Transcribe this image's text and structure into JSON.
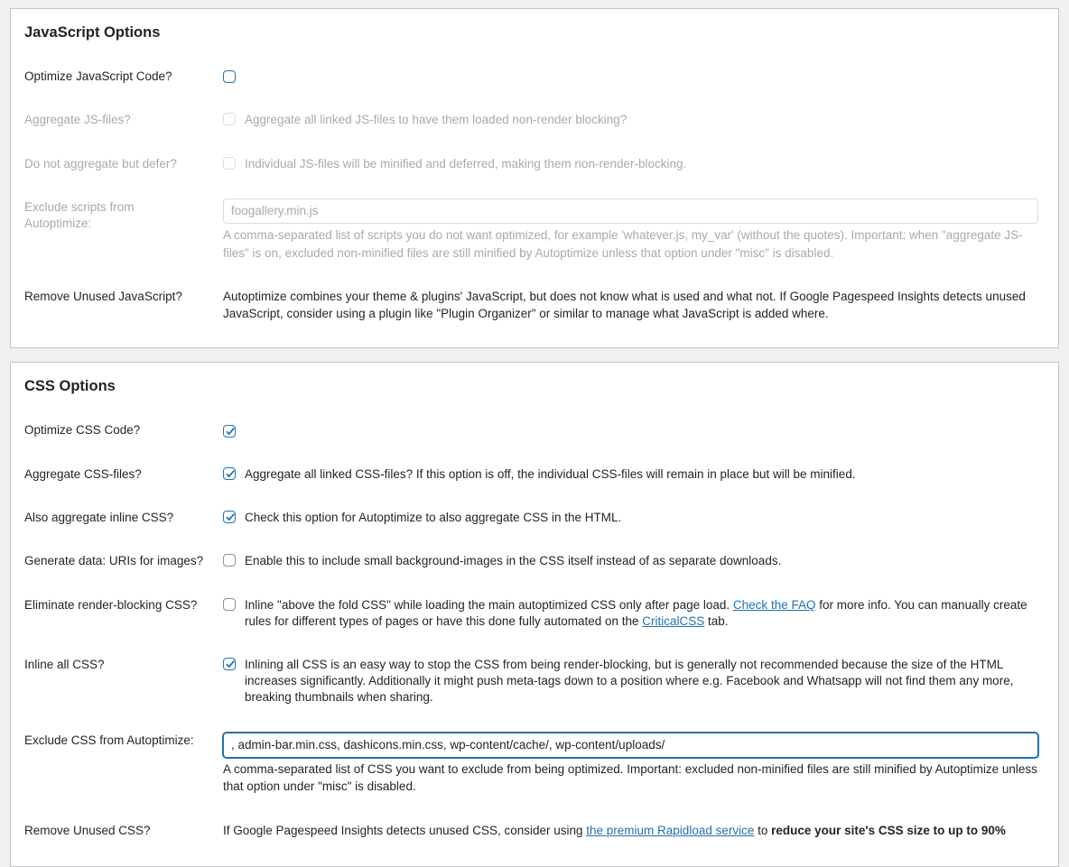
{
  "js": {
    "title": "JavaScript Options",
    "optimize": {
      "label": "Optimize JavaScript Code?",
      "checked": false
    },
    "aggregate": {
      "label": "Aggregate JS-files?",
      "text": "Aggregate all linked JS-files to have them loaded non-render blocking?",
      "checked": false
    },
    "defer": {
      "label": "Do not aggregate but defer?",
      "text": "Individual JS-files will be minified and deferred, making them non-render-blocking.",
      "checked": false
    },
    "exclude": {
      "label": "Exclude scripts from Autoptimize:",
      "value": "foogallery.min.js",
      "desc": "A comma-separated list of scripts you do not want optimized, for example 'whatever.js, my_var' (without the quotes). Important: when \"aggregate JS-files\" is on, excluded non-minified files are still minified by Autoptimize unless that option under \"misc\" is disabled."
    },
    "unused": {
      "label": "Remove Unused JavaScript?",
      "text": "Autoptimize combines your theme & plugins' JavaScript, but does not know what is used and what not. If Google Pagespeed Insights detects unused JavaScript, consider using a plugin like \"Plugin Organizer\" or similar to manage what JavaScript is added where."
    }
  },
  "css": {
    "title": "CSS Options",
    "optimize": {
      "label": "Optimize CSS Code?",
      "checked": true
    },
    "aggregate": {
      "label": "Aggregate CSS-files?",
      "text": "Aggregate all linked CSS-files? If this option is off, the individual CSS-files will remain in place but will be minified.",
      "checked": true
    },
    "inline_agg": {
      "label": "Also aggregate inline CSS?",
      "text": "Check this option for Autoptimize to also aggregate CSS in the HTML.",
      "checked": true
    },
    "data_uri": {
      "label": "Generate data: URIs for images?",
      "text": "Enable this to include small background-images in the CSS itself instead of as separate downloads.",
      "checked": false
    },
    "render_block": {
      "label": "Eliminate render-blocking CSS?",
      "text_a": "Inline \"above the fold CSS\" while loading the main autoptimized CSS only after page load. ",
      "link_faq": "Check the FAQ",
      "text_b": " for more info. You can manually create rules for different types of pages or have this done fully automated on the ",
      "link_critical": "CriticalCSS",
      "text_c": " tab.",
      "checked": false
    },
    "inline_all": {
      "label": "Inline all CSS?",
      "text": "Inlining all CSS is an easy way to stop the CSS from being render-blocking, but is generally not recommended because the size of the HTML increases significantly. Additionally it might push meta-tags down to a position where e.g. Facebook and Whatsapp will not find them any more, breaking thumbnails when sharing.",
      "checked": true
    },
    "exclude": {
      "label": "Exclude CSS from Autoptimize:",
      "value": ", admin-bar.min.css, dashicons.min.css, wp-content/cache/, wp-content/uploads/",
      "desc": "A comma-separated list of CSS you want to exclude from being optimized. Important: excluded non-minified files are still minified by Autoptimize unless that option under \"misc\" is disabled."
    },
    "unused": {
      "label": "Remove Unused CSS?",
      "text_a": "If Google Pagespeed Insights detects unused CSS, consider using ",
      "link": "the premium Rapidload service",
      "text_b": " to ",
      "bold": "reduce your site's CSS size to up to 90%"
    }
  },
  "colors": {
    "accent": "#2271b1",
    "disabled": "#a7aaad"
  }
}
